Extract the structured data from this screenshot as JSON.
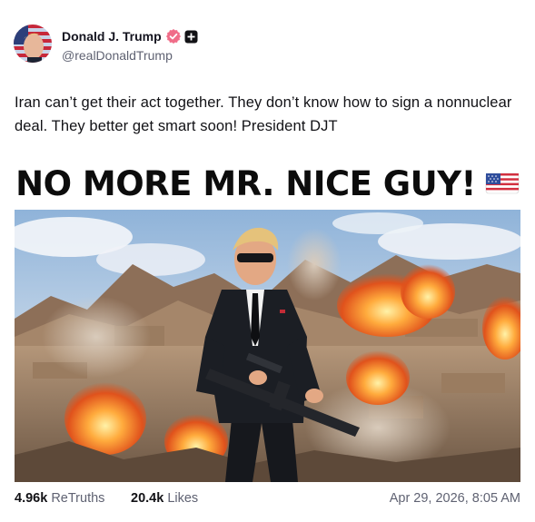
{
  "author": {
    "display_name": "Donald J. Trump",
    "handle": "@realDonaldTrump",
    "verified_icon": "verified-badge-icon",
    "badge_color": "#f26b8a"
  },
  "post": {
    "text": "Iran can’t get their act together. They don’t know how to sign a nonnuclear deal. They better get smart soon! President DJT"
  },
  "media": {
    "headline": "NO MORE MR. NICE GUY!",
    "headline_emoji": "flag-usa-icon"
  },
  "stats": {
    "retruths_count": "4.96k",
    "retruths_label": "ReTruths",
    "likes_count": "20.4k",
    "likes_label": "Likes"
  },
  "timestamp": "Apr 29, 2026, 8:05 AM"
}
